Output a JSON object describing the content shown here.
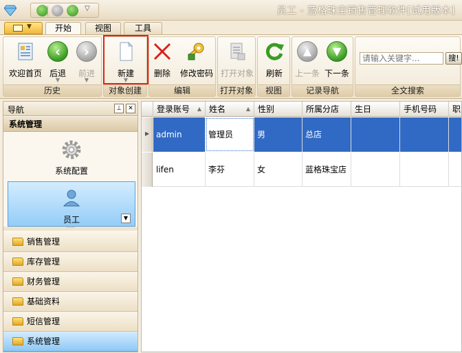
{
  "window": {
    "title": "员工 - 蓝格珠宝销售管理软件[试用版本]"
  },
  "tabs": [
    {
      "label": "开始",
      "active": true
    },
    {
      "label": "视图",
      "active": false
    },
    {
      "label": "工具",
      "active": false
    }
  ],
  "ribbon": {
    "groups": {
      "history": "历史",
      "create": "对象创建",
      "edit": "编辑",
      "open": "打开对象",
      "view": "视图",
      "recnav": "记录导航",
      "search": "全文搜索"
    },
    "buttons": {
      "home": "欢迎首页",
      "back": "后退",
      "forward": "前进",
      "new": "新建",
      "delete": "删除",
      "change_password": "修改密码",
      "open_object": "打开对象",
      "refresh": "刷新",
      "prev": "上一条",
      "next": "下一条"
    },
    "search": {
      "placeholder": "请输入关键字...",
      "button": "搜!"
    }
  },
  "nav": {
    "title": "导航",
    "group_title": "系统管理",
    "big_items": [
      {
        "label": "系统配置",
        "selected": false
      },
      {
        "label": "员工",
        "selected": true
      }
    ],
    "items": [
      {
        "label": "销售管理",
        "active": false
      },
      {
        "label": "库存管理",
        "active": false
      },
      {
        "label": "财务管理",
        "active": false
      },
      {
        "label": "基础资料",
        "active": false
      },
      {
        "label": "短信管理",
        "active": false
      },
      {
        "label": "系统管理",
        "active": true
      }
    ]
  },
  "grid": {
    "columns": [
      "登录账号",
      "姓名",
      "性别",
      "所属分店",
      "生日",
      "手机号码",
      "职"
    ],
    "rows": [
      [
        "admin",
        "管理员",
        "男",
        "总店",
        "",
        "",
        ""
      ],
      [
        "lifen",
        "李芬",
        "女",
        "蓝格珠宝店",
        "",
        "",
        ""
      ]
    ]
  },
  "colors": {
    "selection": "#316ac5",
    "highlight_box": "#e0201a",
    "nav_selected": "#94cdf7"
  }
}
